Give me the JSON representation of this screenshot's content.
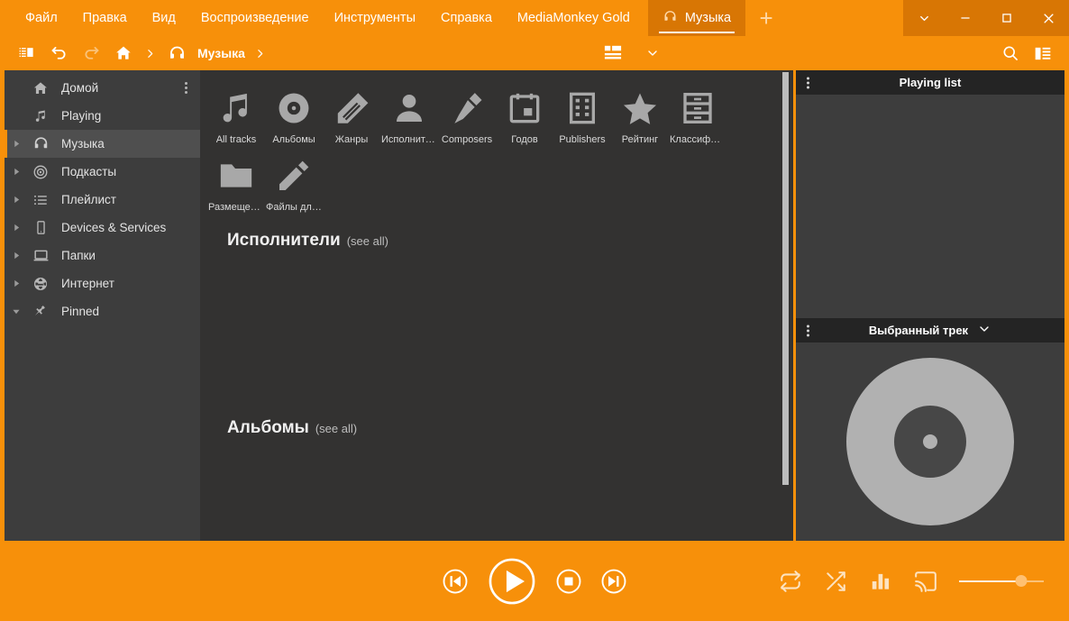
{
  "window": {
    "menus": [
      {
        "label": "Файл"
      },
      {
        "label": "Правка"
      },
      {
        "label": "Вид"
      },
      {
        "label": "Воспроизведение"
      },
      {
        "label": "Инструменты"
      },
      {
        "label": "Справка"
      },
      {
        "label": "MediaMonkey Gold"
      }
    ],
    "tabs": [
      {
        "label": "Музыка",
        "icon": "headphones-icon",
        "active": true
      }
    ],
    "add_tab_label": "+",
    "controls": {
      "more": "chevron-down-icon",
      "minimize": "minimize-icon",
      "maximize": "maximize-icon",
      "close": "close-icon"
    },
    "accent_color": "#f7900a",
    "titlebar_color": "#f7900a",
    "tab_color": "#d87604"
  },
  "toolbar": {
    "panel_toggle": "layout-panel-icon",
    "undo": "undo-icon",
    "redo": "redo-icon",
    "home": "home-icon",
    "breadcrumb_label": "Музыка",
    "breadcrumb_icon": "headphones-icon",
    "view_layout": "view-layout-icon",
    "view_dropdown": "chevron-down-icon",
    "search": "search-icon",
    "right_panel_toggle": "right-panel-icon"
  },
  "sidebar": {
    "items": [
      {
        "label": "Домой",
        "icon": "home-icon",
        "expandable": false,
        "selected": false,
        "more": true
      },
      {
        "label": "Playing",
        "icon": "music-note-icon",
        "expandable": false,
        "selected": false
      },
      {
        "label": "Музыка",
        "icon": "headphones-icon",
        "expandable": true,
        "selected": true
      },
      {
        "label": "Подкасты",
        "icon": "podcast-icon",
        "expandable": true,
        "selected": false
      },
      {
        "label": "Плейлист",
        "icon": "list-icon",
        "expandable": true,
        "selected": false
      },
      {
        "label": "Devices & Services",
        "icon": "phone-icon",
        "expandable": true,
        "selected": false
      },
      {
        "label": "Папки",
        "icon": "laptop-icon",
        "expandable": true,
        "selected": false
      },
      {
        "label": "Интернет",
        "icon": "globe-icon",
        "expandable": true,
        "selected": false
      },
      {
        "label": "Pinned",
        "icon": "pin-icon",
        "expandable": true,
        "expanded": true,
        "selected": false
      }
    ]
  },
  "main": {
    "categories": [
      {
        "label": "All tracks",
        "icon": "music-note-icon"
      },
      {
        "label": "Альбомы",
        "icon": "vinyl-disc-icon"
      },
      {
        "label": "Жанры",
        "icon": "genre-tag-icon"
      },
      {
        "label": "Исполните...",
        "icon": "person-icon"
      },
      {
        "label": "Composers",
        "icon": "pen-nib-icon"
      },
      {
        "label": "Годов",
        "icon": "calendar-icon"
      },
      {
        "label": "Publishers",
        "icon": "building-icon"
      },
      {
        "label": "Рейтинг",
        "icon": "star-icon"
      },
      {
        "label": "Классифик...",
        "icon": "file-cabinet-icon"
      },
      {
        "label": "Размещение",
        "icon": "folder-icon"
      },
      {
        "label": "Файлы для...",
        "icon": "pencil-icon"
      }
    ],
    "sections": [
      {
        "title": "Исполнители",
        "see_all": "(see all)"
      },
      {
        "title": "Альбомы",
        "see_all": "(see all)"
      }
    ]
  },
  "right_panel": {
    "playing_list": {
      "title": "Playing list",
      "menu": "more-vertical-icon"
    },
    "selected_track": {
      "title": "Выбранный трек",
      "menu": "more-vertical-icon",
      "collapse": "chevron-down-icon",
      "artwork": "vinyl-record-placeholder"
    }
  },
  "player": {
    "previous": "previous-track-icon",
    "play": "play-icon",
    "stop": "stop-icon",
    "next": "next-track-icon",
    "repeat": "repeat-icon",
    "shuffle": "shuffle-icon",
    "equalizer": "equalizer-icon",
    "cast": "cast-icon",
    "volume_percent": 73
  }
}
